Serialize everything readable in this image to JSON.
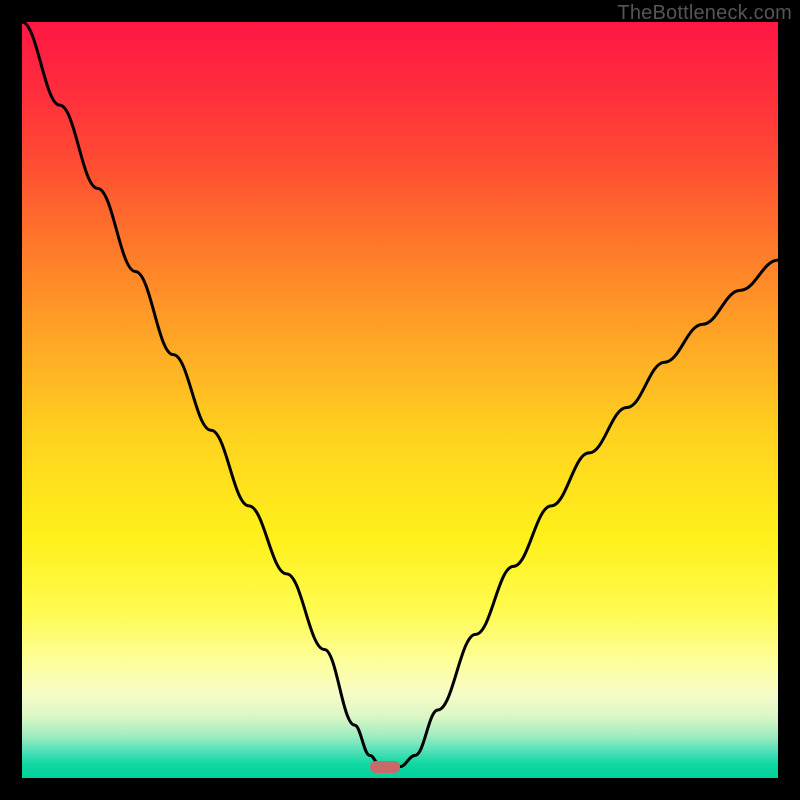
{
  "watermark": "TheBottleneck.com",
  "marker": {
    "x_frac": 0.48,
    "y_frac": 0.985
  },
  "chart_data": {
    "type": "line",
    "title": "",
    "xlabel": "",
    "ylabel": "",
    "xlim": [
      0,
      1
    ],
    "ylim": [
      0,
      1
    ],
    "series": [
      {
        "name": "bottleneck-curve",
        "x": [
          0.0,
          0.05,
          0.1,
          0.15,
          0.2,
          0.25,
          0.3,
          0.35,
          0.4,
          0.44,
          0.46,
          0.475,
          0.5,
          0.52,
          0.55,
          0.6,
          0.65,
          0.7,
          0.75,
          0.8,
          0.85,
          0.9,
          0.95,
          1.0
        ],
        "y": [
          1.0,
          0.89,
          0.78,
          0.67,
          0.56,
          0.46,
          0.36,
          0.27,
          0.17,
          0.07,
          0.03,
          0.015,
          0.015,
          0.03,
          0.09,
          0.19,
          0.28,
          0.36,
          0.43,
          0.49,
          0.55,
          0.6,
          0.645,
          0.685
        ]
      }
    ],
    "gradient_stops": [
      {
        "pos": 0.0,
        "color": "#ff1744"
      },
      {
        "pos": 0.3,
        "color": "#ff7a2a"
      },
      {
        "pos": 0.55,
        "color": "#ffd31f"
      },
      {
        "pos": 0.78,
        "color": "#fffb50"
      },
      {
        "pos": 0.92,
        "color": "#d9f6c5"
      },
      {
        "pos": 1.0,
        "color": "#00d29a"
      }
    ],
    "marker": {
      "x": 0.48,
      "y": 0.015,
      "color": "#c96a6a"
    }
  }
}
